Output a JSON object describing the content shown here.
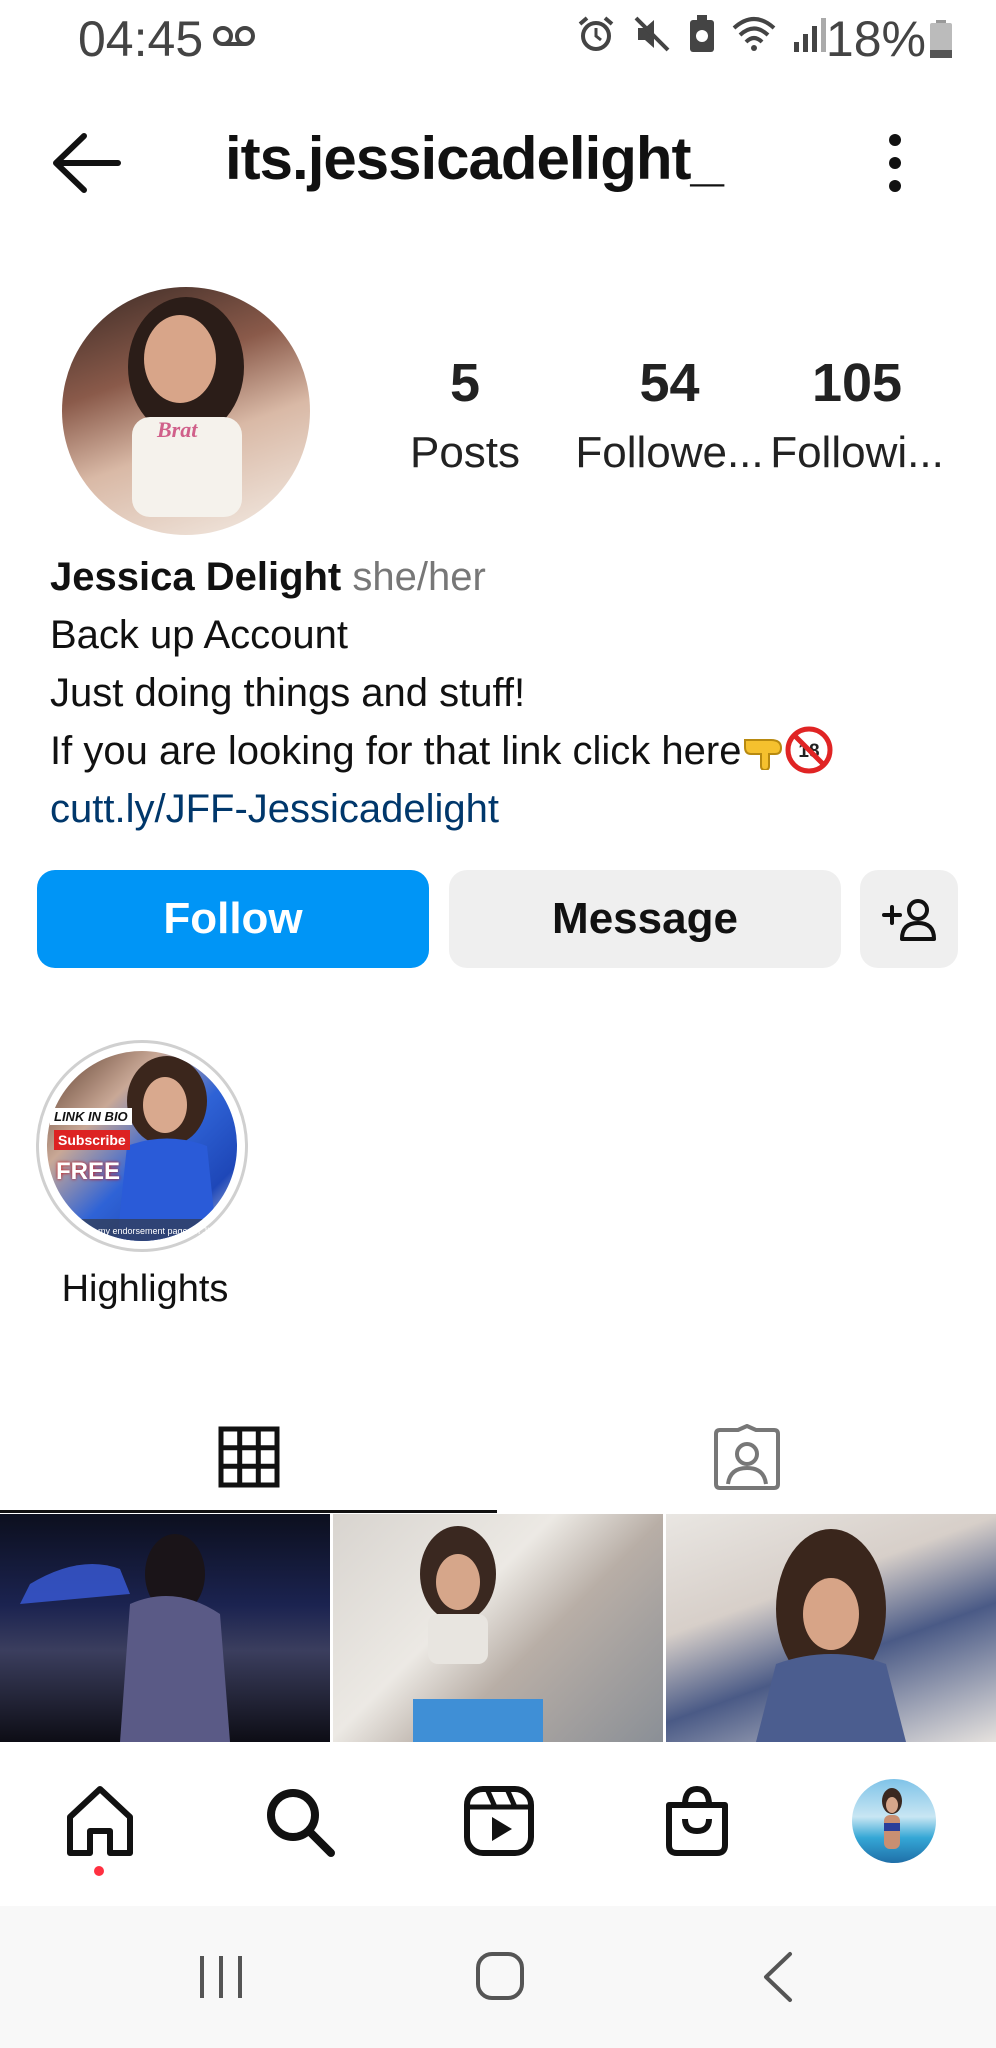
{
  "status_bar": {
    "time": "04:45",
    "battery": "18%",
    "icons": [
      "voicemail-icon",
      "alarm-icon",
      "mute-icon",
      "battery-saver-icon",
      "wifi-icon",
      "signal-icon",
      "battery-icon"
    ]
  },
  "header": {
    "username": "its.jessicadelight_"
  },
  "stats": {
    "posts_value": "5",
    "posts_label": "Posts",
    "followers_value": "54",
    "followers_label": "Followe...",
    "following_value": "105",
    "following_label": "Followi..."
  },
  "bio": {
    "name": "Jessica Delight",
    "pronouns": "she/her",
    "line1": "Back up Account",
    "line2": "Just doing things and stuff!",
    "line3": "If you are looking for that link click here",
    "link": "cutt.ly/JFF-Jessicadelight"
  },
  "buttons": {
    "follow": "Follow",
    "message": "Message"
  },
  "highlights": {
    "label": "Highlights",
    "cover_text": [
      "LINK IN BIO",
      "Subscribe",
      "FREE",
      "to my endorsement page on JUSTFORFANS"
    ]
  },
  "tabs": [
    "grid-icon",
    "tagged-icon"
  ],
  "nav": [
    "home-icon",
    "search-icon",
    "reels-icon",
    "shop-icon",
    "profile-avatar"
  ],
  "colors": {
    "accent": "#0095f6",
    "link": "#00376b",
    "secondary_button": "#efefef",
    "notification_dot": "#ff3040"
  }
}
